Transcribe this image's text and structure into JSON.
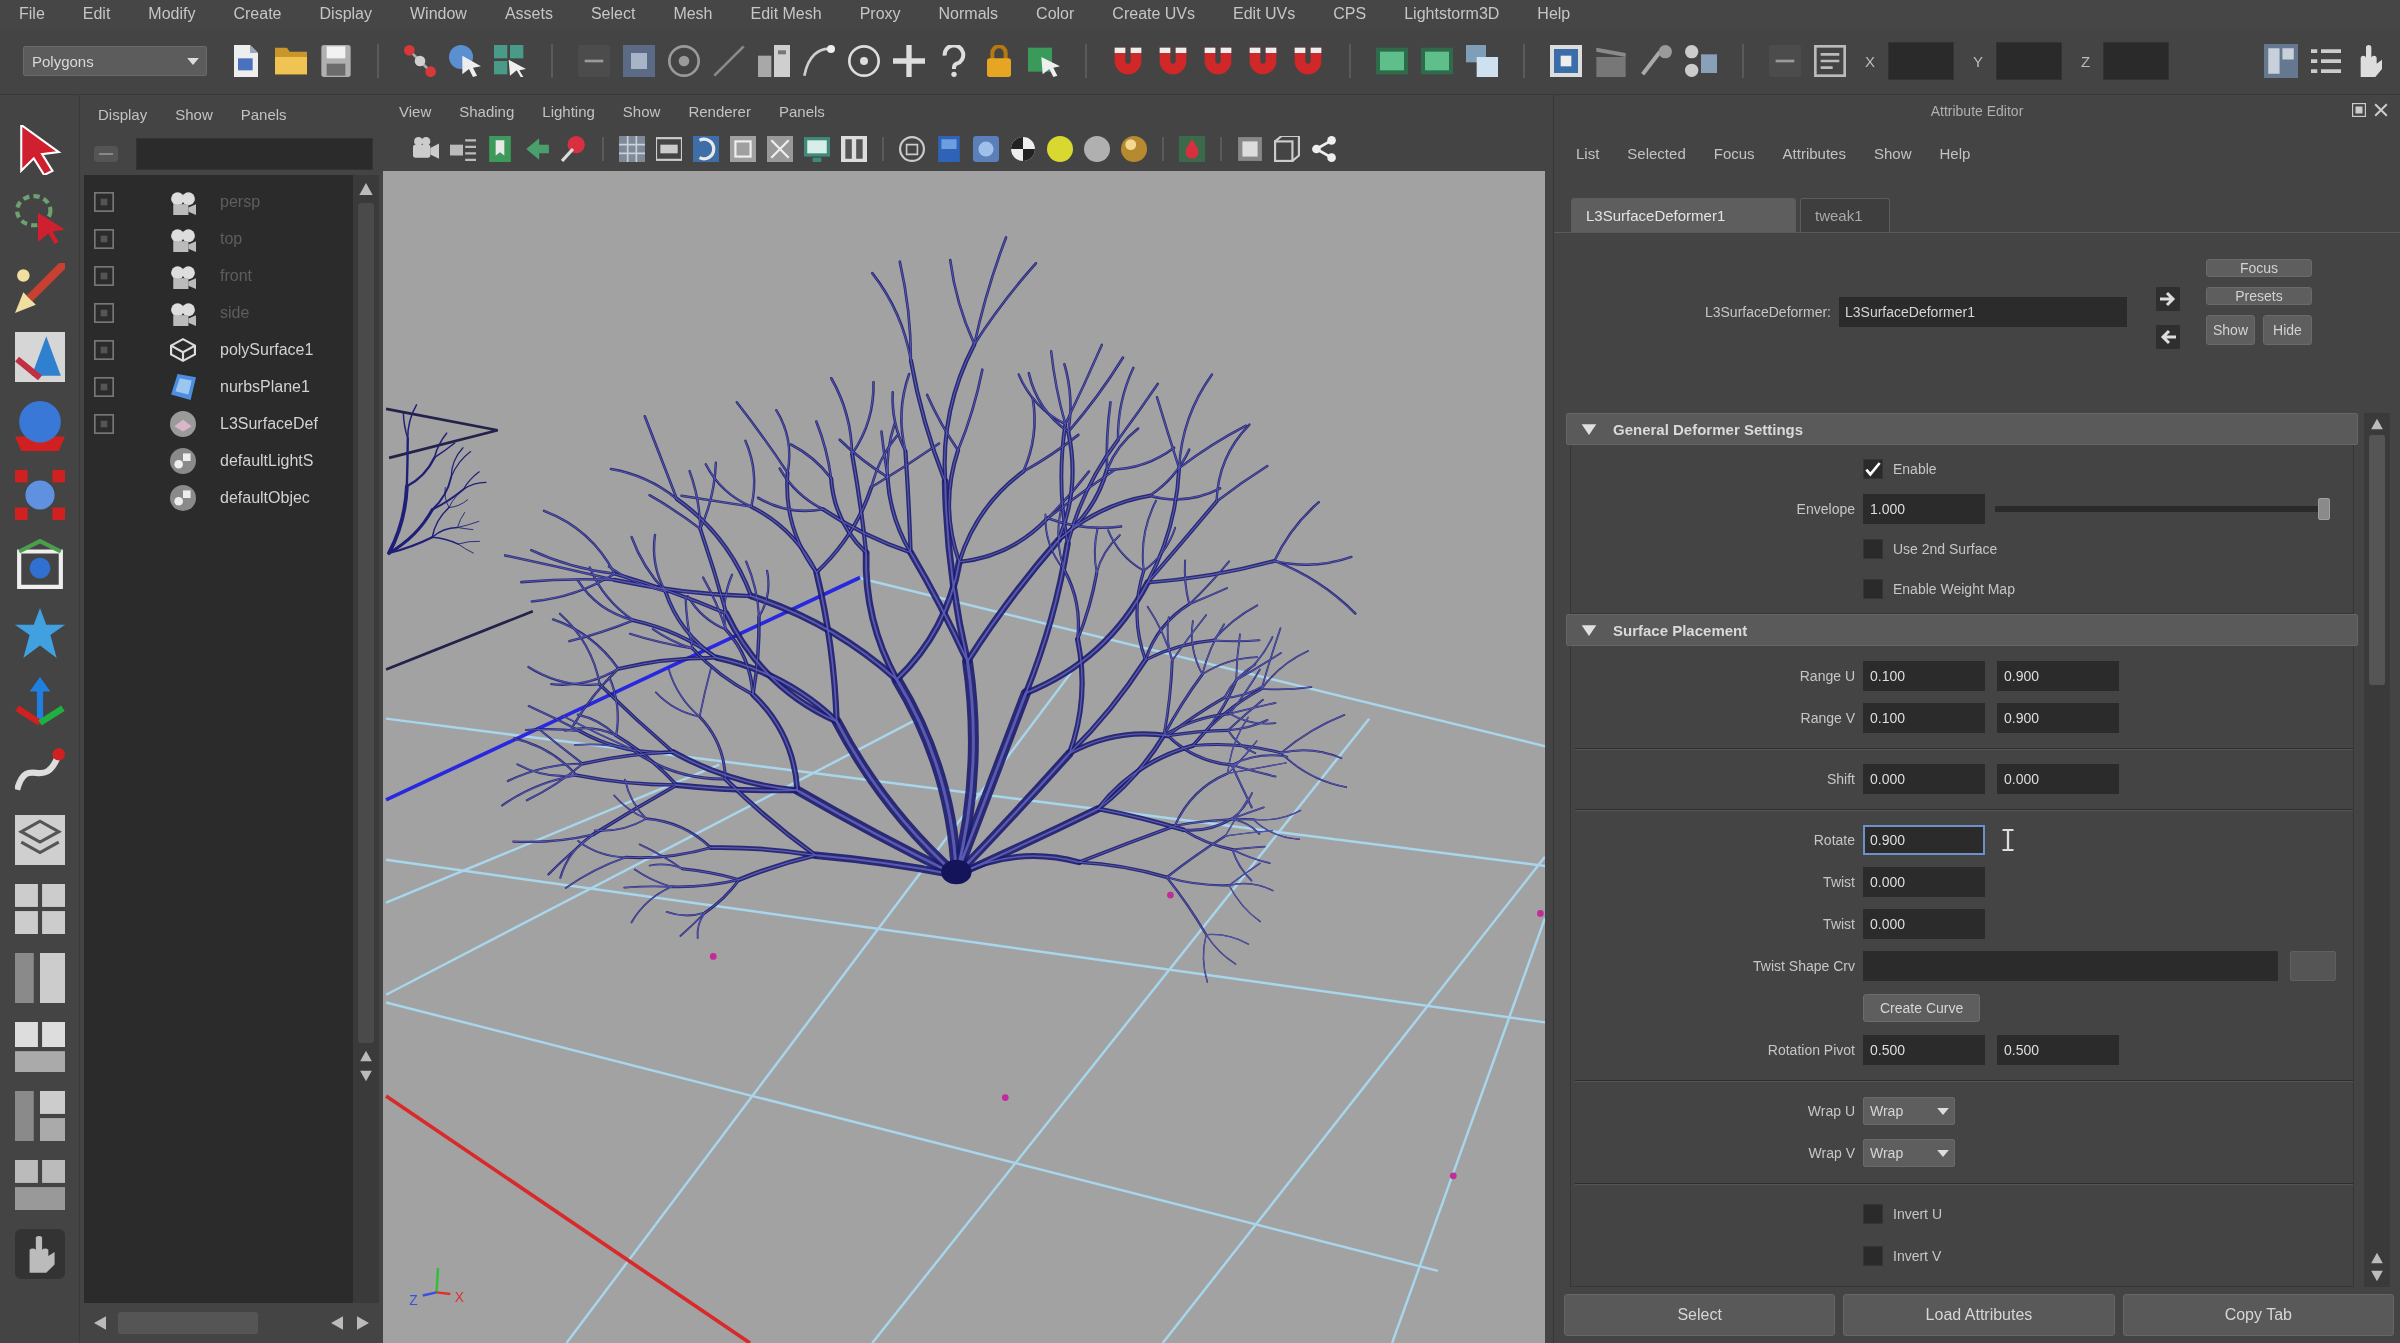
{
  "menu_bar": {
    "items": [
      "File",
      "Edit",
      "Modify",
      "Create",
      "Display",
      "Window",
      "Assets",
      "Select",
      "Mesh",
      "Edit Mesh",
      "Proxy",
      "Normals",
      "Color",
      "Create UVs",
      "Edit UVs",
      "CPS",
      "Lightstorm3D",
      "Help"
    ]
  },
  "status_line": {
    "menu_set": "Polygons",
    "transform_fields": [
      {
        "label": "X"
      },
      {
        "label": "Y"
      },
      {
        "label": "Z"
      }
    ]
  },
  "outliner": {
    "menu": [
      "Display",
      "Show",
      "Panels"
    ],
    "items": [
      {
        "name": "persp",
        "kind": "camera",
        "dimmed": true,
        "toggle_box": true
      },
      {
        "name": "top",
        "kind": "camera",
        "dimmed": true,
        "toggle_box": true
      },
      {
        "name": "front",
        "kind": "camera",
        "dimmed": true,
        "toggle_box": true
      },
      {
        "name": "side",
        "kind": "camera",
        "dimmed": true,
        "toggle_box": true
      },
      {
        "name": "polySurface1",
        "kind": "mesh",
        "dimmed": false,
        "toggle_box": true
      },
      {
        "name": "nurbsPlane1",
        "kind": "nurbs",
        "dimmed": false,
        "toggle_box": true
      },
      {
        "name": "L3SurfaceDef",
        "kind": "deformer",
        "dimmed": false,
        "toggle_box": true
      },
      {
        "name": "defaultLightS",
        "kind": "set",
        "dimmed": false,
        "toggle_box": false
      },
      {
        "name": "defaultObjec",
        "kind": "set",
        "dimmed": false,
        "toggle_box": false
      }
    ]
  },
  "viewport": {
    "menu": [
      "View",
      "Shading",
      "Lighting",
      "Show",
      "Renderer",
      "Panels"
    ],
    "view_axes": [
      {
        "label": "Z",
        "color": "#3a4fe0"
      },
      {
        "label": "X",
        "color": "#e0302a"
      }
    ]
  },
  "attribute_editor": {
    "title": "Attribute Editor",
    "menu": [
      "List",
      "Selected",
      "Focus",
      "Attributes",
      "Show",
      "Help"
    ],
    "tabs": [
      {
        "label": "L3SurfaceDeformer1",
        "selected": true
      },
      {
        "label": "tweak1",
        "selected": false
      }
    ],
    "node": {
      "label": "L3SurfaceDeformer:",
      "value": "L3SurfaceDeformer1"
    },
    "side_buttons": [
      "Focus",
      "Presets",
      "Show",
      "Hide"
    ],
    "sections": [
      {
        "title": "General Deformer Settings",
        "expanded": true,
        "groups": [
          [
            {
              "kind": "checkbox",
              "label": "Enable",
              "checked": true
            },
            {
              "kind": "slider",
              "label": "Envelope",
              "value": "1.000",
              "level": 1
            },
            {
              "kind": "checkbox",
              "label": "Use 2nd Surface",
              "checked": false
            },
            {
              "kind": "checkbox",
              "label": "Enable Weight Map",
              "checked": false
            }
          ]
        ]
      },
      {
        "title": "Surface Placement",
        "expanded": true,
        "groups": [
          [
            {
              "kind": "pair",
              "label": "Range U",
              "values": [
                "0.100",
                "0.900"
              ]
            },
            {
              "kind": "pair",
              "label": "Range V",
              "values": [
                "0.100",
                "0.900"
              ]
            }
          ],
          [
            {
              "kind": "pair",
              "label": "Shift",
              "values": [
                "0.000",
                "0.000"
              ]
            }
          ],
          [
            {
              "kind": "field",
              "label": "Rotate",
              "value": "0.900",
              "focused": true
            },
            {
              "kind": "field",
              "label": "Twist",
              "value": "0.000",
              "focused": false
            },
            {
              "kind": "field",
              "label": "Twist",
              "value": "0.000",
              "focused": false
            },
            {
              "kind": "curve",
              "label": "Twist Shape Crv"
            },
            {
              "kind": "button",
              "label": "Create Curve"
            },
            {
              "kind": "pair",
              "label": "Rotation Pivot",
              "values": [
                "0.500",
                "0.500"
              ]
            }
          ],
          [
            {
              "kind": "dropdown",
              "label": "Wrap U",
              "value": "Wrap"
            },
            {
              "kind": "dropdown",
              "label": "Wrap V",
              "value": "Wrap"
            }
          ],
          [
            {
              "kind": "checkbox",
              "label": "Invert U",
              "checked": false
            },
            {
              "kind": "checkbox",
              "label": "Invert V",
              "checked": false
            }
          ]
        ]
      }
    ],
    "bottom_buttons": [
      "Select",
      "Load Attributes",
      "Copy Tab"
    ]
  }
}
